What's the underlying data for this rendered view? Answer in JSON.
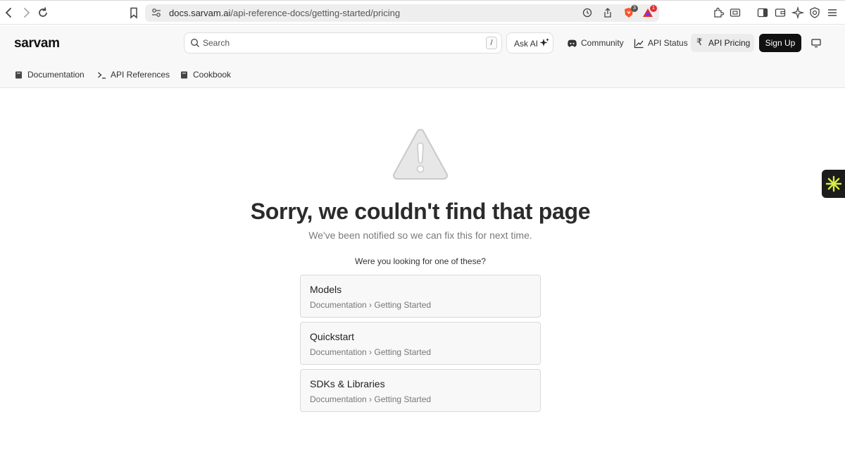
{
  "browser": {
    "url_domain": "docs.sarvam.ai",
    "url_path": "/api-reference-docs/getting-started/pricing",
    "shield_badge": "3",
    "alert_badge": "1"
  },
  "header": {
    "logo": "sarvam",
    "search_placeholder": "Search",
    "search_shortcut": "/",
    "ask_ai": "Ask AI",
    "community": "Community",
    "api_status": "API Status",
    "pricing_symbol": "₹",
    "api_pricing": "API Pricing",
    "sign_up": "Sign Up",
    "tabs": [
      {
        "label": "Documentation"
      },
      {
        "label": "API References"
      },
      {
        "label": "Cookbook"
      }
    ]
  },
  "main": {
    "title": "Sorry, we couldn't find that page",
    "subtitle": "We've been notified so we can fix this for next time.",
    "prompt": "Were you looking for one of these?",
    "suggestions": [
      {
        "title": "Models",
        "path": "Documentation › Getting Started"
      },
      {
        "title": "Quickstart",
        "path": "Documentation › Getting Started"
      },
      {
        "title": "SDKs & Libraries",
        "path": "Documentation › Getting Started"
      }
    ]
  },
  "colors": {
    "signup_bg": "#111111",
    "widget_star": "#d8ef3c",
    "brave_orange": "#fb542b",
    "alert_red": "#e0312f"
  }
}
